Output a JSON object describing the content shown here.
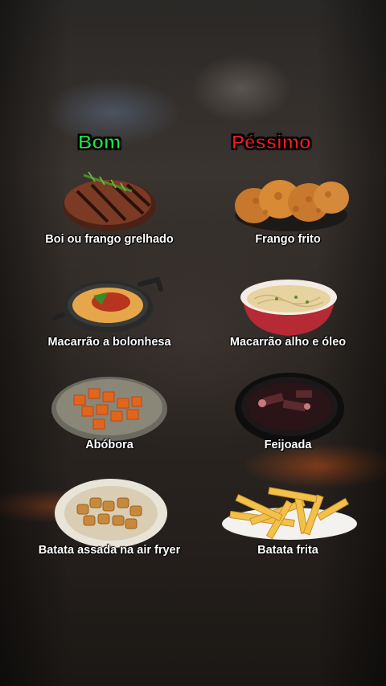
{
  "columns": {
    "good_title": "Bom",
    "bad_title": "Péssimo"
  },
  "rows": [
    {
      "good": "Boi ou frango grelhado",
      "bad": "Frango frito"
    },
    {
      "good": "Macarrão a bolonhesa",
      "bad": "Macarrão alho e óleo"
    },
    {
      "good": "Abóbora",
      "bad": "Feijoada"
    },
    {
      "good": "Batata assada na air fryer",
      "bad": "Batata frita"
    }
  ],
  "colors": {
    "good": "#1ee84a",
    "bad": "#f21b1b"
  }
}
